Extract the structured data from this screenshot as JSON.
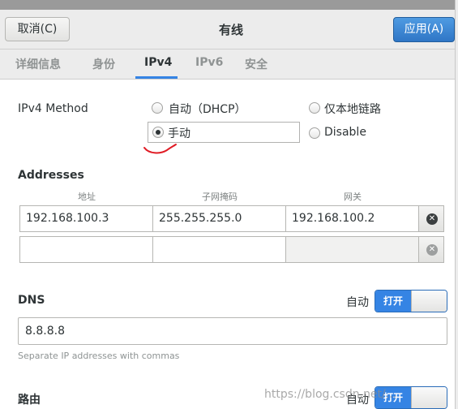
{
  "header": {
    "cancel_label": "取消(C)",
    "title": "有线",
    "apply_label": "应用(A)"
  },
  "tabs": [
    {
      "label": "详细信息"
    },
    {
      "label": "身份"
    },
    {
      "label": "IPv4"
    },
    {
      "label": "IPv6"
    },
    {
      "label": "安全"
    }
  ],
  "ipv4_method": {
    "label": "IPv4 Method",
    "options": [
      {
        "label": "自动（DHCP）"
      },
      {
        "label": "仅本地链路"
      },
      {
        "label": "手动"
      },
      {
        "label": "Disable"
      }
    ],
    "selected": "手动"
  },
  "addresses": {
    "title": "Addresses",
    "columns": [
      "地址",
      "子网掩码",
      "网关"
    ],
    "rows": [
      [
        "192.168.100.3",
        "255.255.255.0",
        "192.168.100.2"
      ],
      [
        "",
        "",
        ""
      ]
    ]
  },
  "dns": {
    "title": "DNS",
    "auto_label": "自动",
    "switch_label": "打开",
    "value": "8.8.8.8",
    "hint": "Separate IP addresses with commas"
  },
  "routes": {
    "title": "路由",
    "auto_label": "自动",
    "switch_label": "打开"
  },
  "watermark": "https://blog.csdn.net/...",
  "colors": {
    "accent": "#3584e4",
    "annotation": "#e01b24"
  }
}
